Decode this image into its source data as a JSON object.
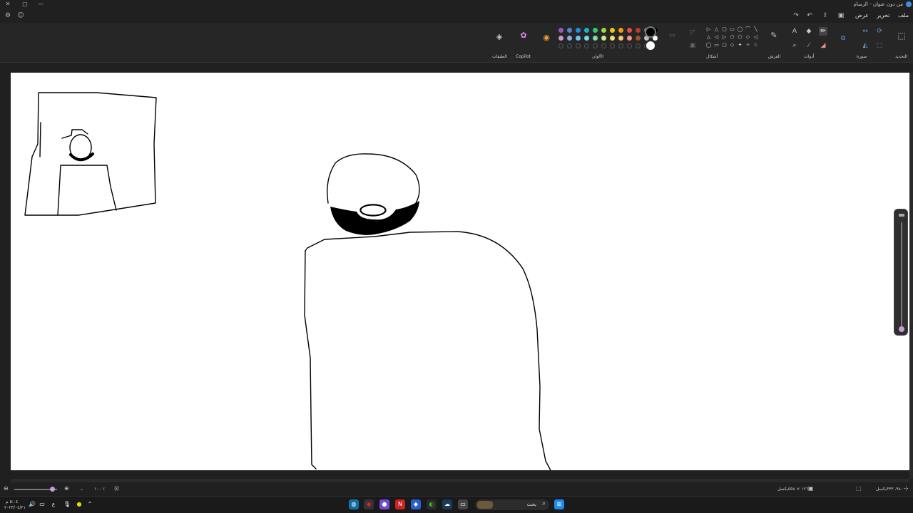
{
  "window": {
    "title": "من دون عنوان - الرسام",
    "close": "✕",
    "minimize": "—",
    "app_icon": "paint-app-icon"
  },
  "menu": {
    "file": "ملف",
    "edit": "تحرير",
    "view": "عرض"
  },
  "ribbon": {
    "groups": {
      "select": "التحديد",
      "image": "صورة",
      "tools": "أدوات",
      "brushes": "الفرش",
      "shapes": "أشكال",
      "colors": "الألوان",
      "copilot": "Copilot",
      "layers": "الطبقات"
    },
    "colors": {
      "primary": "#000000",
      "secondary": "#ffffff",
      "palette_row1": [
        "#9b59b6",
        "#5b7fd6",
        "#1f8fe0",
        "#19b3c8",
        "#2ecc71",
        "#a6d63a",
        "#f1c40f",
        "#f39c12",
        "#e74c3c",
        "#c0392b",
        "#7f7f7f",
        "#000000"
      ],
      "palette_row2": [
        "#c39bd3",
        "#8fa8e8",
        "#6ec1f0",
        "#79d9e4",
        "#7be0a5",
        "#cbe98a",
        "#f7dc6f",
        "#f8c471",
        "#f1948a",
        "#a0522d",
        "#bfbfbf",
        "#ffffff"
      ]
    }
  },
  "status": {
    "canvas_size": "١٢٦٠ × ٥٥٨بكسل",
    "cursor_pos": "٩٨٠، ٣٣٣بكسل",
    "zoom": "١٠٠ ٪"
  },
  "taskbar": {
    "search_label": "بحث",
    "time": "٥:٠٤ م",
    "date": "٢٠٢٣/٠٤/٢١",
    "lang": "ع"
  }
}
